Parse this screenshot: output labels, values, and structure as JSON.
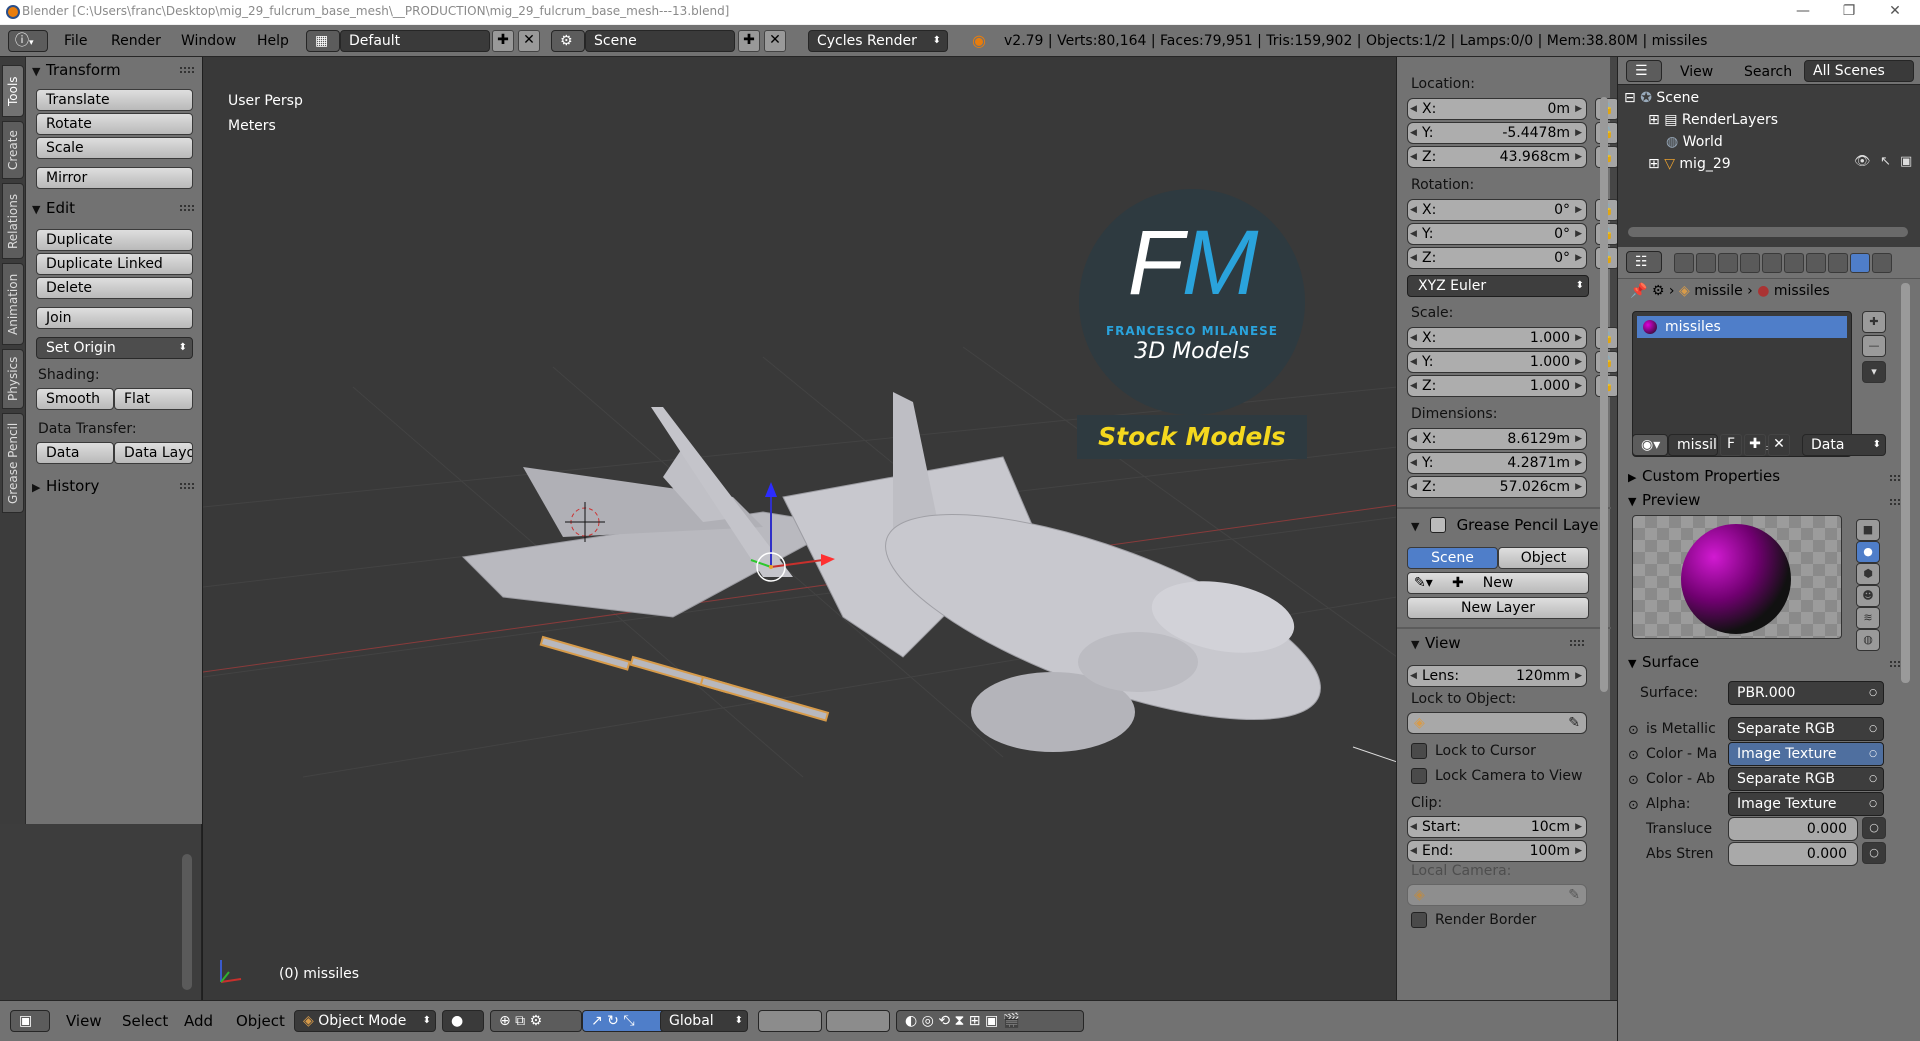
{
  "window": {
    "title": "Blender [C:\\Users\\franc\\Desktop\\mig_29_fulcrum_base_mesh\\__PRODUCTION\\mig_29_fulcrum_base_mesh---13.blend]",
    "minimize": "—",
    "maximize": "❐",
    "close": "✕"
  },
  "topbar": {
    "menus": [
      "File",
      "Render",
      "Window",
      "Help"
    ],
    "layout": "Default",
    "scene": "Scene",
    "engine": "Cycles Render",
    "stats": "v2.79 | Verts:80,164 | Faces:79,951 | Tris:159,902 | Objects:1/2 | Lamps:0/0 | Mem:38.80M | missiles"
  },
  "side_tabs": [
    "Tools",
    "Create",
    "Relations",
    "Animation",
    "Physics",
    "Grease Pencil"
  ],
  "toolshelf": {
    "transform": {
      "header": "Transform",
      "buttons": [
        "Translate",
        "Rotate",
        "Scale",
        "Mirror"
      ]
    },
    "edit": {
      "header": "Edit",
      "buttons": [
        "Duplicate",
        "Duplicate Linked",
        "Delete",
        "Join"
      ],
      "set_origin": "Set Origin",
      "shading_label": "Shading:",
      "smooth": "Smooth",
      "flat": "Flat",
      "data_transfer_label": "Data Transfer:",
      "data": "Data",
      "data_layout": "Data Layo"
    },
    "history": "History"
  },
  "viewport": {
    "view_name": "User Persp",
    "units": "Meters",
    "object_label": "(0) missiles",
    "logo_main": "FM",
    "logo_brand": "FRANCESCO MILANESE",
    "logo_sub": "3D Models",
    "logo_stock": "Stock Models"
  },
  "nprops": {
    "location_label": "Location:",
    "location": [
      [
        "X:",
        "0m"
      ],
      [
        "Y:",
        "-5.4478m"
      ],
      [
        "Z:",
        "43.968cm"
      ]
    ],
    "rotation_label": "Rotation:",
    "rotation": [
      [
        "X:",
        "0°"
      ],
      [
        "Y:",
        "0°"
      ],
      [
        "Z:",
        "0°"
      ]
    ],
    "rotation_mode": "XYZ Euler",
    "scale_label": "Scale:",
    "scale": [
      [
        "X:",
        "1.000"
      ],
      [
        "Y:",
        "1.000"
      ],
      [
        "Z:",
        "1.000"
      ]
    ],
    "dimensions_label": "Dimensions:",
    "dimensions": [
      [
        "X:",
        "8.6129m"
      ],
      [
        "Y:",
        "4.2871m"
      ],
      [
        "Z:",
        "57.026cm"
      ]
    ],
    "gp_header": "Grease Pencil Layer",
    "gp_scene": "Scene",
    "gp_object": "Object",
    "gp_new": "New",
    "gp_new_layer": "New Layer",
    "view_header": "View",
    "lens_label": "Lens:",
    "lens_value": "120mm",
    "lock_object_label": "Lock to Object:",
    "lock_cursor": "Lock to Cursor",
    "lock_camera": "Lock Camera to View",
    "clip_label": "Clip:",
    "clip_start_label": "Start:",
    "clip_start": "10cm",
    "clip_end_label": "End:",
    "clip_end": "100m",
    "local_camera_label": "Local Camera:",
    "render_border": "Render Border"
  },
  "bottombar": {
    "menus": [
      "View",
      "Select",
      "Add",
      "Object"
    ],
    "mode": "Object Mode",
    "orientation": "Global"
  },
  "outliner": {
    "view": "View",
    "search": "Search",
    "filter": "All Scenes",
    "items": [
      "Scene",
      "RenderLayers",
      "World",
      "mig_29"
    ]
  },
  "properties": {
    "breadcrumb_object": "missile",
    "breadcrumb_material": "missiles",
    "material_slot": "missiles",
    "material_name": "missil",
    "fake_user": "F",
    "link": "Data",
    "custom_properties": "Custom Properties",
    "preview": "Preview",
    "surface_header": "Surface",
    "surface_label": "Surface:",
    "surface_value": "PBR.000",
    "inputs": [
      {
        "label": "is Metallic",
        "value": "Separate RGB"
      },
      {
        "label": "Color - Ma",
        "value": "Image Texture"
      },
      {
        "label": "Color - Ab",
        "value": "Separate RGB"
      },
      {
        "label": "Alpha:",
        "value": "Image Texture"
      }
    ],
    "translucency_label": "Transluce",
    "translucency": "0.000",
    "abs_strength_label": "Abs Stren",
    "abs_strength": "0.000"
  },
  "colors": {
    "panel": "#727272",
    "viewport_bg": "#393939",
    "selection_blue": "#4f7ec9",
    "accent_orange": "#e87d0d",
    "logo_cyan": "#2aa3dc",
    "logo_yellow": "#f5d81e"
  }
}
